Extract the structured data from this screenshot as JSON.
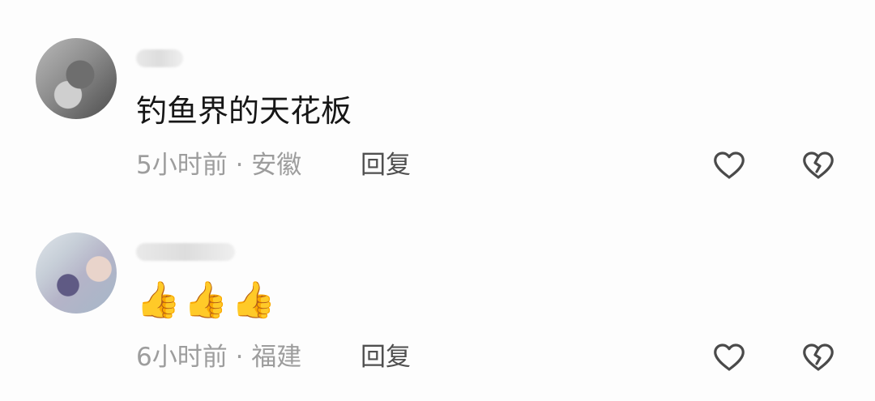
{
  "comments": [
    {
      "text": "钓鱼界的天花板",
      "meta": "5小时前 · 安徽",
      "reply": "回复",
      "icons": {
        "like": "heart-icon",
        "dislike": "broken-heart-icon"
      }
    },
    {
      "text": "👍👍👍",
      "meta": "6小时前 · 福建",
      "reply": "回复",
      "icons": {
        "like": "heart-icon",
        "dislike": "broken-heart-icon"
      }
    }
  ],
  "colors": {
    "background": "#fdfdfd",
    "primary_text": "#161616",
    "secondary_text": "#9d9d9d",
    "reply_text": "#4f4f4f",
    "icon_stroke": "#4a4a4a"
  }
}
